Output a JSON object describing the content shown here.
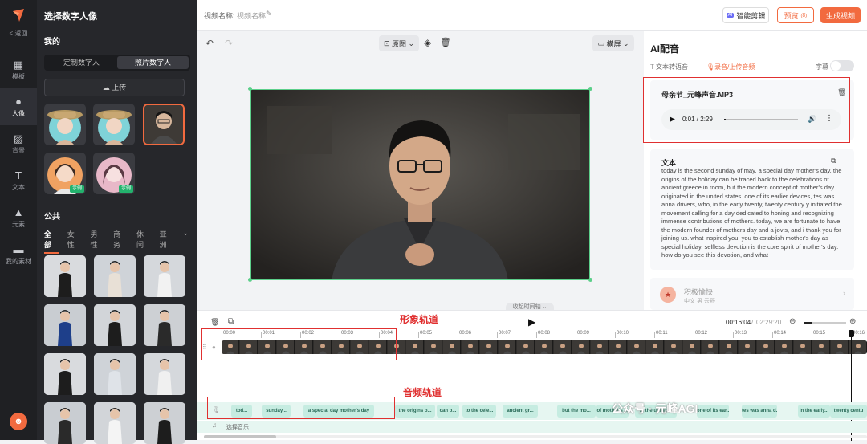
{
  "rail": {
    "back_label": "< 返回",
    "items": [
      {
        "label": "模板",
        "icon": "grid-icon"
      },
      {
        "label": "人像",
        "icon": "person-icon"
      },
      {
        "label": "背景",
        "icon": "background-icon"
      },
      {
        "label": "文本",
        "icon": "text-icon"
      },
      {
        "label": "元素",
        "icon": "shapes-icon"
      },
      {
        "label": "我的素材",
        "icon": "folder-icon"
      }
    ]
  },
  "panel": {
    "title": "选择数字人像",
    "mine_heading": "我的",
    "tabs": [
      "定制数字人",
      "照片数字人"
    ],
    "upload_label": "上传",
    "mine_badges": [
      "示例",
      "示例"
    ],
    "public_heading": "公共",
    "public_tabs": [
      "全部",
      "女性",
      "男性",
      "商务",
      "休闲",
      "亚洲"
    ]
  },
  "topbar": {
    "name_label": "视频名称:",
    "name_placeholder": "视频名称",
    "smart_cut": "智能剪辑",
    "preview": "预览",
    "generate": "生成视频"
  },
  "canvas": {
    "bg_label": "原图",
    "orientation": "横屏",
    "collapse_label": "收起时间轴"
  },
  "right": {
    "title": "AI配音",
    "tab_tts": "文本转语音",
    "tab_record": "录音/上传音频",
    "subtitle_label": "字幕",
    "audio_file": "母亲节_元峰声音.MP3",
    "audio_time": "0:01 / 2:29",
    "text_heading": "文本",
    "text_body": "today is the second sunday of may, a special day mother's day. the origins of the holiday can be traced back to the celebrations of ancient greece in room, but the modern concept of mother's day originated in the united states. one of its earlier devices, tes was anna drivers, who, in the early twenty, twenty century y initiated the movement calling for a day dedicated to honing and recognizing immense contributions of mothers. today, we are fortunate to have the modern founder of mothers day and a jovis, and i thank you for joining us. what inspired you, you to establish mother's day as special holiday. selfless devotion is the core spirit of mother's day. how do you see this devotion, and what",
    "voice_name": "积极愉快",
    "voice_meta": "中文  男  云野"
  },
  "timeline": {
    "current": "00:16:04",
    "total": "02:29:20",
    "ticks": [
      "00:00",
      "00:01",
      "00:02",
      "00:03",
      "00:04",
      "00:05",
      "00:06",
      "00:07",
      "00:08",
      "00:09",
      "00:10",
      "00:11",
      "00:12",
      "00:13",
      "00:14",
      "00:15",
      "00:16"
    ],
    "image_track_annotation": "形象轨道",
    "audio_track_annotation": "音频轨道",
    "music_label": "选择音乐",
    "segments": [
      "tod...",
      "sunday...",
      "a special day mother's day",
      "the origins o...",
      "can b...",
      "to the cele...",
      "ancient gr...",
      "but the mo...",
      "of mother's ...",
      "in the united...",
      "one of its ear...",
      "tes was anna d...",
      "in the early...",
      "twenty centu"
    ]
  },
  "watermark": "公众号 · 元峰AGI"
}
